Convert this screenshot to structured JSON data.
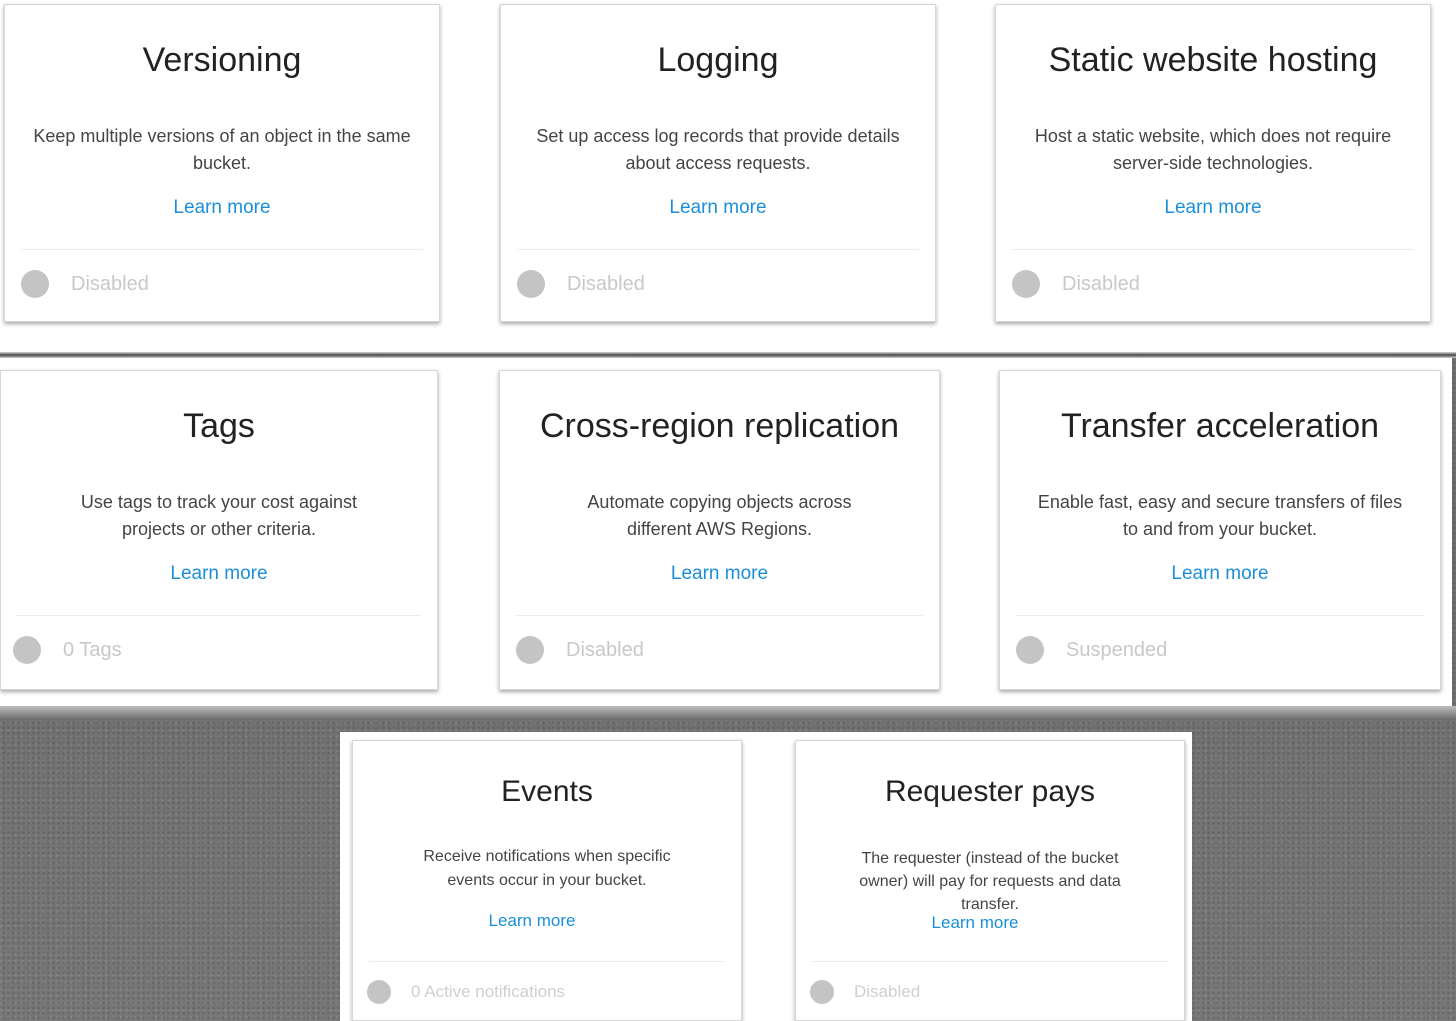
{
  "cards": [
    {
      "title": "Versioning",
      "description": "Keep multiple versions of an object in the same bucket.",
      "link": "Learn more",
      "status": "Disabled"
    },
    {
      "title": "Logging",
      "description": "Set up access log records that provide details about access requests.",
      "link": "Learn more",
      "status": "Disabled"
    },
    {
      "title": "Static website hosting",
      "description": "Host a static website, which does not require server-side technologies.",
      "link": "Learn more",
      "status": "Disabled"
    },
    {
      "title": "Tags",
      "description": "Use tags to track your cost against projects or other criteria.",
      "link": "Learn more",
      "status": "0 Tags"
    },
    {
      "title": "Cross-region replication",
      "description": "Automate copying objects across different AWS Regions.",
      "link": "Learn more",
      "status": "Disabled"
    },
    {
      "title": "Transfer acceleration",
      "description": "Enable fast, easy and secure transfers of files to and from your bucket.",
      "link": "Learn more",
      "status": "Suspended"
    },
    {
      "title": "Events",
      "description": "Receive notifications when specific events occur in your bucket.",
      "link": "Learn more",
      "status": "0 Active notifications"
    },
    {
      "title": "Requester pays",
      "description": "The requester (instead of the bucket owner) will pay for requests and data transfer.",
      "link": "Learn more",
      "status": "Disabled"
    }
  ],
  "colors": {
    "link": "#1a8fd8",
    "status_dot": "#c4c4c4",
    "status_text": "#c8c8c8"
  }
}
